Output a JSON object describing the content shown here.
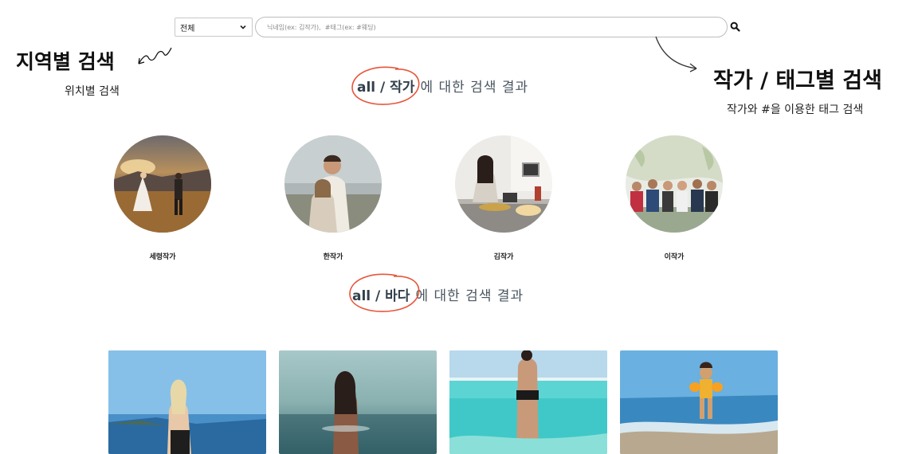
{
  "search": {
    "select_value": "전체",
    "placeholder": "닉네임(ex: 김작가),  #태그(ex: #웨딩)"
  },
  "annotations": {
    "left_title": "지역별 검색",
    "left_sub": "위치별 검색",
    "right_title": "작가 / 태그별 검색",
    "right_sub": "작가와 #을 이용한 태그 검색"
  },
  "artist_section": {
    "keyword": "all / 작가",
    "rest": "에 대한 검색 결과"
  },
  "artists": [
    {
      "name": "세령작가",
      "photo": "wedding couple at sunset"
    },
    {
      "name": "한작가",
      "photo": "couple hugging by the sea"
    },
    {
      "name": "김작가",
      "photo": "woman cooking in kitchen"
    },
    {
      "name": "이작가",
      "photo": "group of friends on bench"
    }
  ],
  "place_section": {
    "keyword": "all / 바다",
    "rest": "에 대한 검색 결과"
  },
  "places": [
    {
      "photo": "woman standing in the sea"
    },
    {
      "photo": "woman in calm water at sunset"
    },
    {
      "photo": "person wading in turquoise water"
    },
    {
      "photo": "child with armbands on beach"
    }
  ],
  "colors": {
    "accent_ring": "#e8553a",
    "heading_text": "#4a5560"
  },
  "icons": {
    "search": "search-icon",
    "select_arrow": "chevron-down-icon"
  }
}
